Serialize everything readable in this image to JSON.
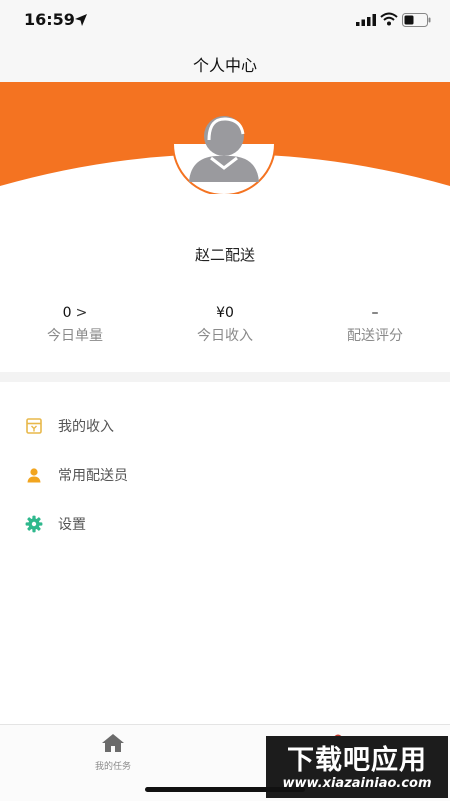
{
  "status_bar": {
    "time": "16:59"
  },
  "header": {
    "title": "个人中心"
  },
  "profile": {
    "name": "赵二配送",
    "accent_color": "#f47321"
  },
  "stats": [
    {
      "value": "0",
      "label": "今日单量",
      "has_chevron": true
    },
    {
      "value": "¥0",
      "label": "今日收入"
    },
    {
      "value": "–",
      "label": "配送评分"
    }
  ],
  "menu": [
    {
      "label": "我的收入",
      "icon": "income-box-icon",
      "color": "#e8b84a"
    },
    {
      "label": "常用配送员",
      "icon": "person-icon",
      "color": "#f2a51f"
    },
    {
      "label": "设置",
      "icon": "gear-icon",
      "color": "#2fb88d"
    }
  ],
  "tab_bar": {
    "tabs": [
      {
        "label": "我的任务",
        "icon": "home-icon"
      },
      {
        "label": "",
        "icon": "person-icon"
      }
    ]
  },
  "watermark": {
    "top": "下载吧应用",
    "bottom": "www.xiazainiao.com"
  }
}
